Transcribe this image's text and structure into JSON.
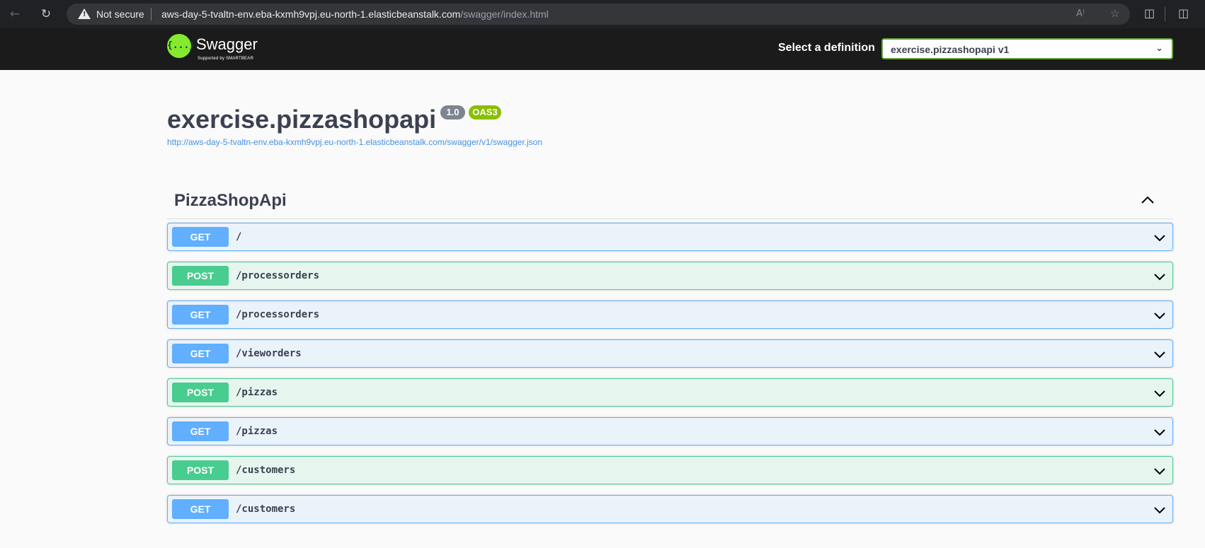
{
  "browser": {
    "security_label": "Not secure",
    "url_host": "aws-day-5-tvaltn-env.eba-kxmh9vpj.eu-north-1.elasticbeanstalk.com",
    "url_path": "/swagger/index.html",
    "icons": [
      "back-icon",
      "reload-icon",
      "warning-icon",
      "read-aloud-icon",
      "favorite-star-icon",
      "extensions-icon",
      "split-screen-icon"
    ]
  },
  "topbar": {
    "logo_mark": "{...}",
    "logo_text": "Swagger",
    "logo_subtext": "Supported by SMARTBEAR",
    "definition_label": "Select a definition",
    "definition_selected": "exercise.pizzashopapi v1"
  },
  "info": {
    "title": "exercise.pizzashopapi",
    "version": "1.0",
    "oas": "OAS3",
    "spec_url": "http://aws-day-5-tvaltn-env.eba-kxmh9vpj.eu-north-1.elasticbeanstalk.com/swagger/v1/swagger.json"
  },
  "tag": {
    "name": "PizzaShopApi",
    "operations": [
      {
        "method": "GET",
        "path": "/"
      },
      {
        "method": "POST",
        "path": "/processorders"
      },
      {
        "method": "GET",
        "path": "/processorders"
      },
      {
        "method": "GET",
        "path": "/vieworders"
      },
      {
        "method": "POST",
        "path": "/pizzas"
      },
      {
        "method": "GET",
        "path": "/pizzas"
      },
      {
        "method": "POST",
        "path": "/customers"
      },
      {
        "method": "GET",
        "path": "/customers"
      }
    ]
  },
  "colors": {
    "get": "#61affe",
    "post": "#49cc90",
    "topbar": "#1b1b1b",
    "logo": "#85ea2d",
    "badge_version": "#7d8492",
    "badge_oas": "#89bf04",
    "link": "#4990e2"
  }
}
